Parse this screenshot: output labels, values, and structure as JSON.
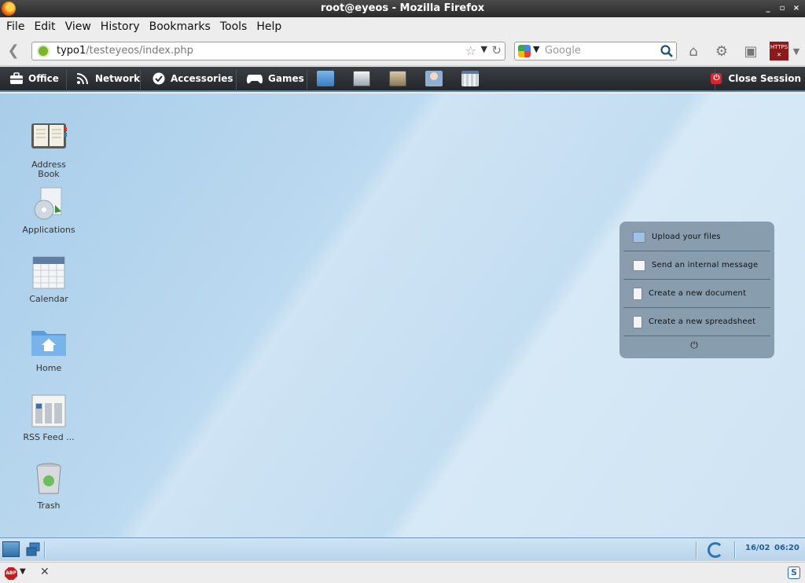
{
  "window": {
    "title": "root@eyeos - Mozilla Firefox",
    "controls": [
      "_",
      "▫",
      "×"
    ]
  },
  "menubar": {
    "items": [
      "File",
      "Edit",
      "View",
      "History",
      "Bookmarks",
      "Tools",
      "Help"
    ]
  },
  "navbar": {
    "url_host": "typo1",
    "url_path": "/testeyeos/index.php",
    "search_placeholder": "Google",
    "https_badge": "HTTPS"
  },
  "eyeos_bar": {
    "menus": [
      {
        "label": "Office",
        "icon": "briefcase-icon"
      },
      {
        "label": "Network",
        "icon": "rss-icon"
      },
      {
        "label": "Accessories",
        "icon": "check-circle-icon"
      },
      {
        "label": "Games",
        "icon": "gamepad-icon"
      }
    ],
    "launchers": [
      "files-icon",
      "document-icon",
      "image-viewer-icon",
      "contacts-icon",
      "calendar-icon"
    ],
    "close_session": "Close Session"
  },
  "desktop": {
    "icons": [
      {
        "label": "Address Book",
        "icon": "address-book-icon"
      },
      {
        "label": "Applications",
        "icon": "applications-icon"
      },
      {
        "label": "Calendar",
        "icon": "calendar-icon"
      },
      {
        "label": "Home",
        "icon": "home-folder-icon"
      },
      {
        "label": "RSS Feed ...",
        "icon": "rss-feed-icon"
      },
      {
        "label": "Trash",
        "icon": "trash-icon"
      }
    ]
  },
  "quick_actions": {
    "items": [
      {
        "label": "Upload your files",
        "icon": "upload-icon"
      },
      {
        "label": "Send an internal message",
        "icon": "envelope-icon"
      },
      {
        "label": "Create a new document",
        "icon": "document-icon"
      },
      {
        "label": "Create a new spreadsheet",
        "icon": "spreadsheet-icon"
      }
    ],
    "power_icon": "power-icon"
  },
  "taskbar": {
    "date": "16/02",
    "time": "06:20"
  },
  "addonbar": {
    "abp": "ABP",
    "s_icon": "S"
  },
  "colors": {
    "desktop": "#bcdaf0",
    "topbar": "#2b2f33",
    "close": "#d8262f",
    "clock": "#1d5f99"
  }
}
